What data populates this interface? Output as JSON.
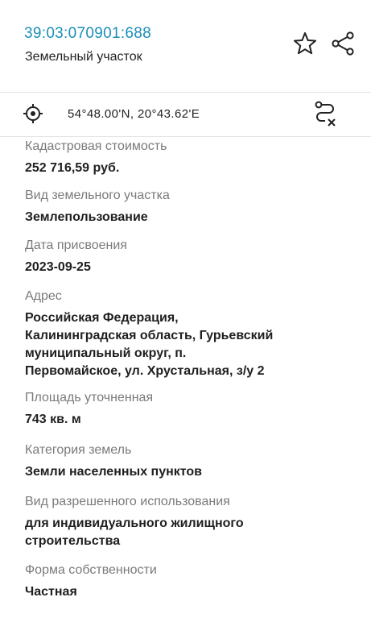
{
  "header": {
    "cadastral_number": "39:03:070901:688",
    "object_type": "Земельный участок",
    "favorite_icon": "star-outline-icon",
    "share_icon": "share-icon"
  },
  "location": {
    "coordinates_text": "54°48.00'N, 20°43.62'E",
    "locate_icon": "crosshair-icon",
    "route_icon": "route-clear-icon"
  },
  "fields": [
    {
      "label": "Кадастровая стоимость",
      "value": "252 716,59 руб."
    },
    {
      "label": "Вид земельного участка",
      "value": "Землепользование"
    },
    {
      "label": "Дата присвоения",
      "value": "2023-09-25"
    },
    {
      "label": "Адрес",
      "value_lines": [
        "Российская Федерация,",
        "Калининградская область, Гурьевский",
        "муниципальный округ, п.",
        "Первомайское, ул. Хрустальная, з/у 2"
      ]
    },
    {
      "label": "Площадь уточненная",
      "value": "743 кв. м"
    },
    {
      "label": "Категория земель",
      "value": "Земли населенных пунктов"
    },
    {
      "label": "Вид разрешенного использования",
      "value_lines": [
        "для индивидуального жилищного",
        "строительства"
      ]
    },
    {
      "label": "Форма собственности",
      "value": "Частная"
    }
  ],
  "colors": {
    "accent": "#1b8fb8",
    "label": "#7a7a7a",
    "text": "#1f1f1f",
    "divider": "#e4e4e4"
  }
}
